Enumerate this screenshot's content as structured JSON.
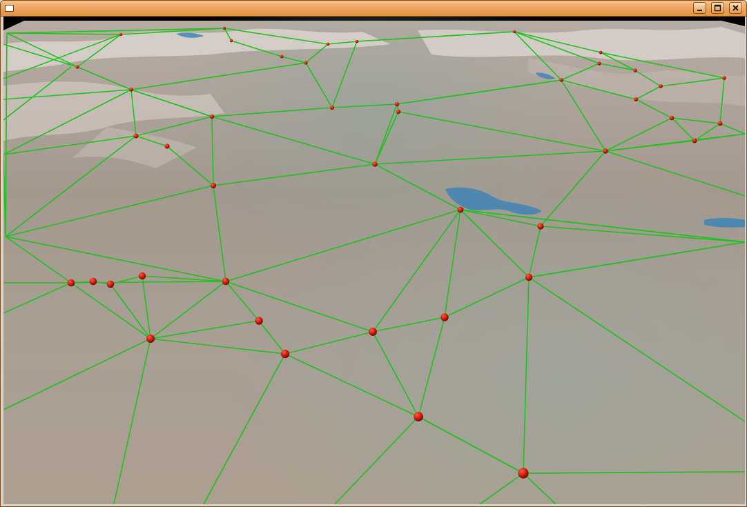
{
  "window": {
    "title": "",
    "icon": "window-icon",
    "controls": [
      {
        "name": "minimize",
        "icon": "minimize-icon"
      },
      {
        "name": "maximize",
        "icon": "maximize-icon"
      },
      {
        "name": "close",
        "icon": "close-icon"
      }
    ]
  },
  "scene": {
    "description_colors": {
      "terrain": "#a89c8c",
      "terrain_ridge": "#ece6e4",
      "water": "#3f84b4",
      "mesh_edges": "#22c21e",
      "vertex_markers": "#d61a0e",
      "sky": "#000000"
    },
    "vertex_count": 49,
    "edge_count": 101
  }
}
